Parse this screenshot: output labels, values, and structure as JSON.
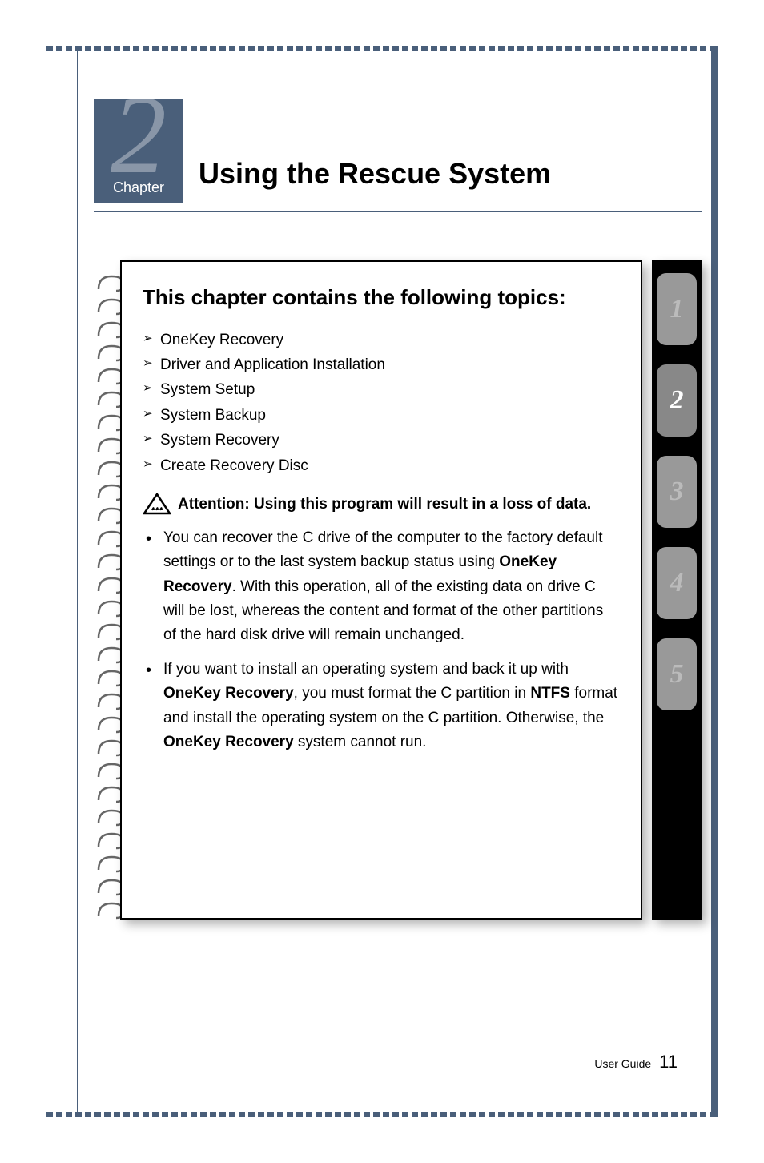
{
  "chapter": {
    "number": "2",
    "label": "Chapter",
    "title": "Using the Rescue System"
  },
  "topicsBox": {
    "heading": "This chapter contains the following topics:",
    "topics": [
      "OneKey Recovery",
      "Driver and Application Installation",
      "System Setup",
      "System Backup",
      "System Recovery",
      "Create Recovery Disc"
    ],
    "attention": "Attention: Using this program will result in a loss of data.",
    "bullets": [
      {
        "parts": [
          {
            "text": "You can recover the C drive of the computer to the factory default settings or to the last system backup status using ",
            "bold": false
          },
          {
            "text": "OneKey Recovery",
            "bold": true
          },
          {
            "text": ". With this operation, all of the existing data on drive C will be lost, whereas the content and format of the other partitions of the hard disk drive will remain unchanged.",
            "bold": false
          }
        ]
      },
      {
        "parts": [
          {
            "text": "If you want to install an operating system and back it up with ",
            "bold": false
          },
          {
            "text": "OneKey Recovery",
            "bold": true
          },
          {
            "text": ", you must format the C partition in ",
            "bold": false
          },
          {
            "text": "NTFS",
            "bold": true
          },
          {
            "text": " format and install the operating system on the C partition. Otherwise, the ",
            "bold": false
          },
          {
            "text": "OneKey Recovery",
            "bold": true
          },
          {
            "text": " system cannot run.",
            "bold": false
          }
        ]
      }
    ]
  },
  "tabs": [
    "1",
    "2",
    "3",
    "4",
    "5"
  ],
  "activeTab": 1,
  "footer": {
    "label": "User Guide",
    "page": "11"
  }
}
